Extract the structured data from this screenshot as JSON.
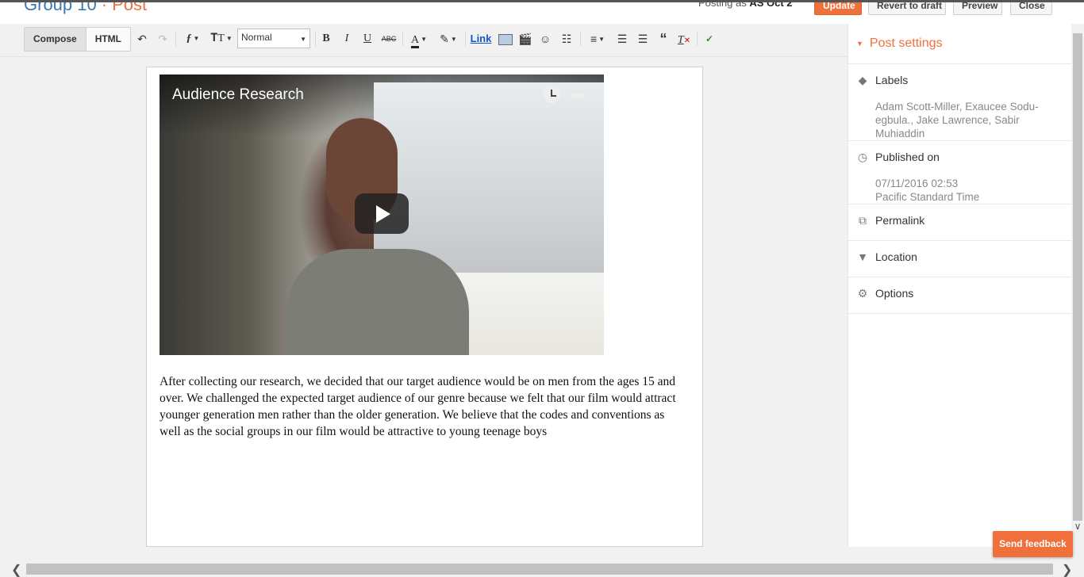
{
  "header": {
    "blog_name": "Group 10",
    "separator": "·",
    "page": "Post",
    "posting_as_prefix": "Posting as",
    "posting_as_user": "AS Oct 2",
    "buttons": {
      "update": "Update",
      "revert": "Revert to draft",
      "preview": "Preview",
      "close": "Close"
    }
  },
  "toolbar": {
    "compose": "Compose",
    "html": "HTML",
    "format_value": "Normal",
    "bold": "B",
    "italic": "I",
    "underline": "U",
    "strike": "ABC",
    "link": "Link"
  },
  "editor": {
    "video": {
      "title": "Audience Research"
    },
    "body": "After collecting our research, we decided that our target audience would be on men from the ages 15 and over. We challenged the expected target audience of our genre because we felt that our film would attract  younger generation men rather than the older generation. We believe that the codes and conventions as well as the social groups in our film would be attractive to young teenage boys"
  },
  "sidebar": {
    "title": "Post settings",
    "labels": {
      "heading": "Labels",
      "value": "Adam Scott-Miller, Exaucee Sodu-egbula., Jake Lawrence, Sabir Muhiaddin"
    },
    "published": {
      "heading": "Published on",
      "date": "07/11/2016 02:53",
      "timezone": "Pacific Standard Time"
    },
    "permalink": {
      "heading": "Permalink"
    },
    "location": {
      "heading": "Location"
    },
    "options": {
      "heading": "Options"
    }
  },
  "feedback": {
    "label": "Send feedback"
  },
  "colors": {
    "accent": "#f0703c",
    "link": "#1155cc"
  }
}
